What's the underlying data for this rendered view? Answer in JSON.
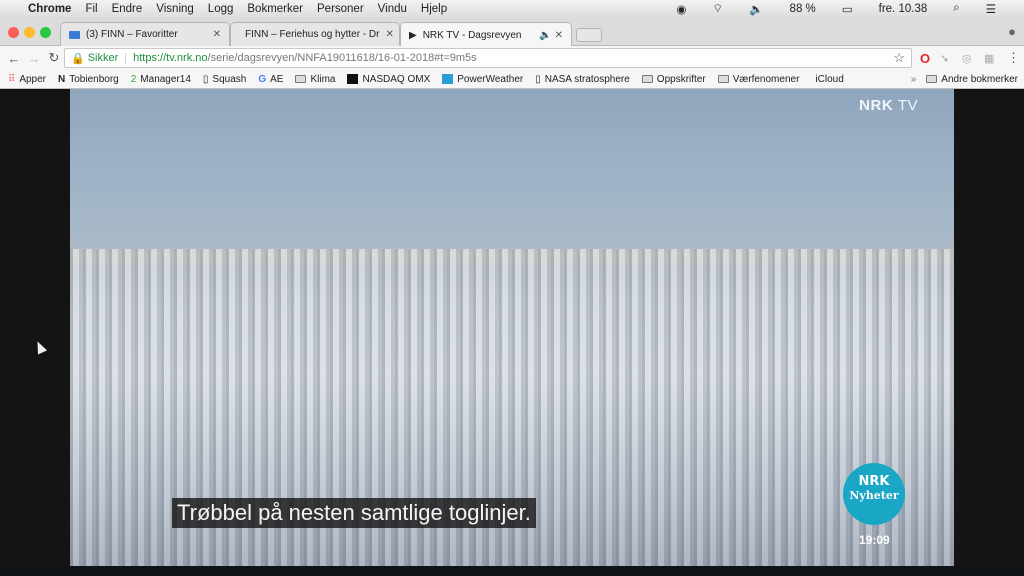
{
  "menubar": {
    "app": "Chrome",
    "items": [
      "Fil",
      "Endre",
      "Visning",
      "Logg",
      "Bokmerker",
      "Personer",
      "Vindu",
      "Hjelp"
    ],
    "battery": "88 %",
    "clock": "fre. 10.38"
  },
  "tabs": [
    {
      "title": "(3) FINN – Favoritter"
    },
    {
      "title": "FINN – Feriehus og hytter - Dr"
    },
    {
      "title": "NRK TV - Dagsrevyen",
      "active": true,
      "audio": true
    }
  ],
  "address": {
    "secure_label": "Sikker",
    "url_host": "https://tv.nrk.no",
    "url_path": "/serie/dagsrevyen/NNFA19011618/16-01-2018#t=9m5s"
  },
  "bookmarks": [
    "Apper",
    "Tobienborg",
    "Manager14",
    "Squash",
    "AE",
    "Klima",
    "NASDAQ OMX",
    "PowerWeather",
    "NASA stratosphere",
    "Oppskrifter",
    "Værfenomener",
    "iCloud"
  ],
  "other_bookmarks": "Andre bokmerker",
  "video": {
    "logo_brand": "NRK",
    "logo_suffix": "TV",
    "subtitle": "Trøbbel på nesten samtlige toglinjer.",
    "badge_brand": "NRK",
    "badge_label": "Nyheter",
    "clock": "19:09"
  },
  "colors": {
    "badge": "#1aa7c5",
    "secure": "#1e8e3e"
  }
}
